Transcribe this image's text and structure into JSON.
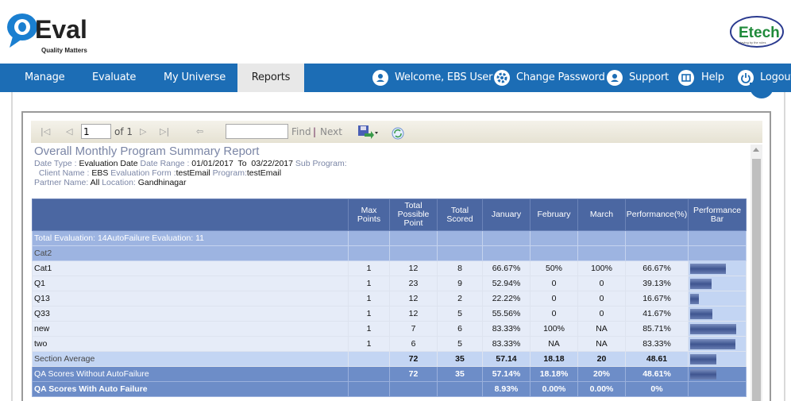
{
  "header": {
    "logo_text": "QEval",
    "logo_tagline": "Quality Matters",
    "client_logo_text": "Etech",
    "client_logo_tagline": "playing by the rules"
  },
  "nav": {
    "items": [
      {
        "label": "Manage"
      },
      {
        "label": "Evaluate"
      },
      {
        "label": "My Universe"
      },
      {
        "label": "Reports",
        "active": true
      }
    ],
    "right": [
      {
        "label": "Welcome, EBS User",
        "icon": "user-icon"
      },
      {
        "label": "Change Password",
        "icon": "gear-icon"
      },
      {
        "label": "Support",
        "icon": "support-icon"
      },
      {
        "label": "Help",
        "icon": "book-icon"
      },
      {
        "label": "Logout",
        "icon": "power-icon"
      }
    ]
  },
  "toolbar": {
    "page_value": "1",
    "page_of": "of 1",
    "find_value": "",
    "find_label": "Find",
    "separator": "|",
    "next_label": "Next"
  },
  "report": {
    "title": "Overall Monthly Program Summary Report",
    "date_type_label": "Date Type : ",
    "date_type_value": "Evaluation Date",
    "date_range_label": " Date Range : ",
    "date_range_value": "01/01/2017  To  03/22/2017",
    "sub_program_label": " Sub Program:",
    "client_name_label": "  Client Name : ",
    "client_name_value": "EBS",
    "eval_form_label": " Evaluation Form :",
    "eval_form_value": "testEmail",
    "program_label": " Program:",
    "program_value": "testEmail",
    "partner_label": "Partner Name: ",
    "partner_value": "All",
    "location_label": " Location: ",
    "location_value": "Gandhinagar"
  },
  "table": {
    "columns": [
      "",
      "Max Points",
      "Total Possible Point",
      "Total Scored",
      "January",
      "February",
      "March",
      "Performance(%)",
      "Performance Bar"
    ],
    "total_row": "Total Evaluation: 14AutoFailure Evaluation: 11",
    "category": "Cat2",
    "rows": [
      {
        "name": "Cat1",
        "max": "1",
        "possible": "12",
        "scored": "8",
        "jan": "66.67%",
        "feb": "50%",
        "mar": "100%",
        "perf": "66.67%",
        "bar": 66.67
      },
      {
        "name": "Q1",
        "max": "1",
        "possible": "23",
        "scored": "9",
        "jan": "52.94%",
        "feb": "0",
        "mar": "0",
        "perf": "39.13%",
        "bar": 39.13
      },
      {
        "name": "Q13",
        "max": "1",
        "possible": "12",
        "scored": "2",
        "jan": "22.22%",
        "feb": "0",
        "mar": "0",
        "perf": "16.67%",
        "bar": 16.67
      },
      {
        "name": "Q33",
        "max": "1",
        "possible": "12",
        "scored": "5",
        "jan": "55.56%",
        "feb": "0",
        "mar": "0",
        "perf": "41.67%",
        "bar": 41.67
      },
      {
        "name": "new",
        "max": "1",
        "possible": "7",
        "scored": "6",
        "jan": "83.33%",
        "feb": "100%",
        "mar": "NA",
        "perf": "85.71%",
        "bar": 85.71
      },
      {
        "name": "two",
        "max": "1",
        "possible": "6",
        "scored": "5",
        "jan": "83.33%",
        "feb": "NA",
        "mar": "NA",
        "perf": "83.33%",
        "bar": 83.33
      }
    ],
    "section_average": {
      "name": "Section Average",
      "max": "",
      "possible": "72",
      "scored": "35",
      "jan": "57.14",
      "feb": "18.18",
      "mar": "20",
      "perf": "48.61",
      "bar": 48.61
    },
    "without_autofail": {
      "name": "QA Scores Without AutoFailure",
      "max": "",
      "possible": "72",
      "scored": "35",
      "jan": "57.14%",
      "feb": "18.18%",
      "mar": "20%",
      "perf": "48.61%",
      "bar": 48.61
    },
    "with_autofail": {
      "name": "QA Scores With Auto Failure",
      "max": "",
      "possible": "",
      "scored": "",
      "jan": "8.93%",
      "feb": "0.00%",
      "mar": "0.00%",
      "perf": "0%",
      "bar": null
    }
  }
}
